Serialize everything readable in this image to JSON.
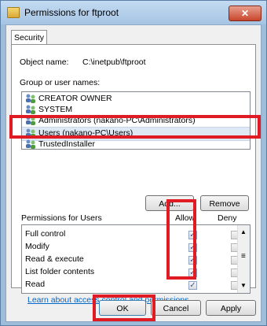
{
  "window": {
    "title": "Permissions for ftproot",
    "close_label": "✕"
  },
  "tab": "Security",
  "object_name_label": "Object name:",
  "object_name_value": "C:\\inetpub\\ftproot",
  "group_label": "Group or user names:",
  "groups": [
    "CREATOR OWNER",
    "SYSTEM",
    "Administrators (nakano-PC\\Administrators)",
    "Users (nakano-PC\\Users)",
    "TrustedInstaller"
  ],
  "buttons": {
    "add": "Add...",
    "remove": "Remove",
    "ok": "OK",
    "cancel": "Cancel",
    "apply": "Apply"
  },
  "permissions_label": "Permissions for Users",
  "allow_label": "Allow",
  "deny_label": "Deny",
  "permissions": [
    {
      "name": "Full control",
      "allow": true,
      "deny": false
    },
    {
      "name": "Modify",
      "allow": true,
      "deny": false
    },
    {
      "name": "Read & execute",
      "allow": true,
      "deny": false
    },
    {
      "name": "List folder contents",
      "allow": true,
      "deny": false
    },
    {
      "name": "Read",
      "allow": true,
      "deny": false
    }
  ],
  "link": "Learn about access control and permissions"
}
